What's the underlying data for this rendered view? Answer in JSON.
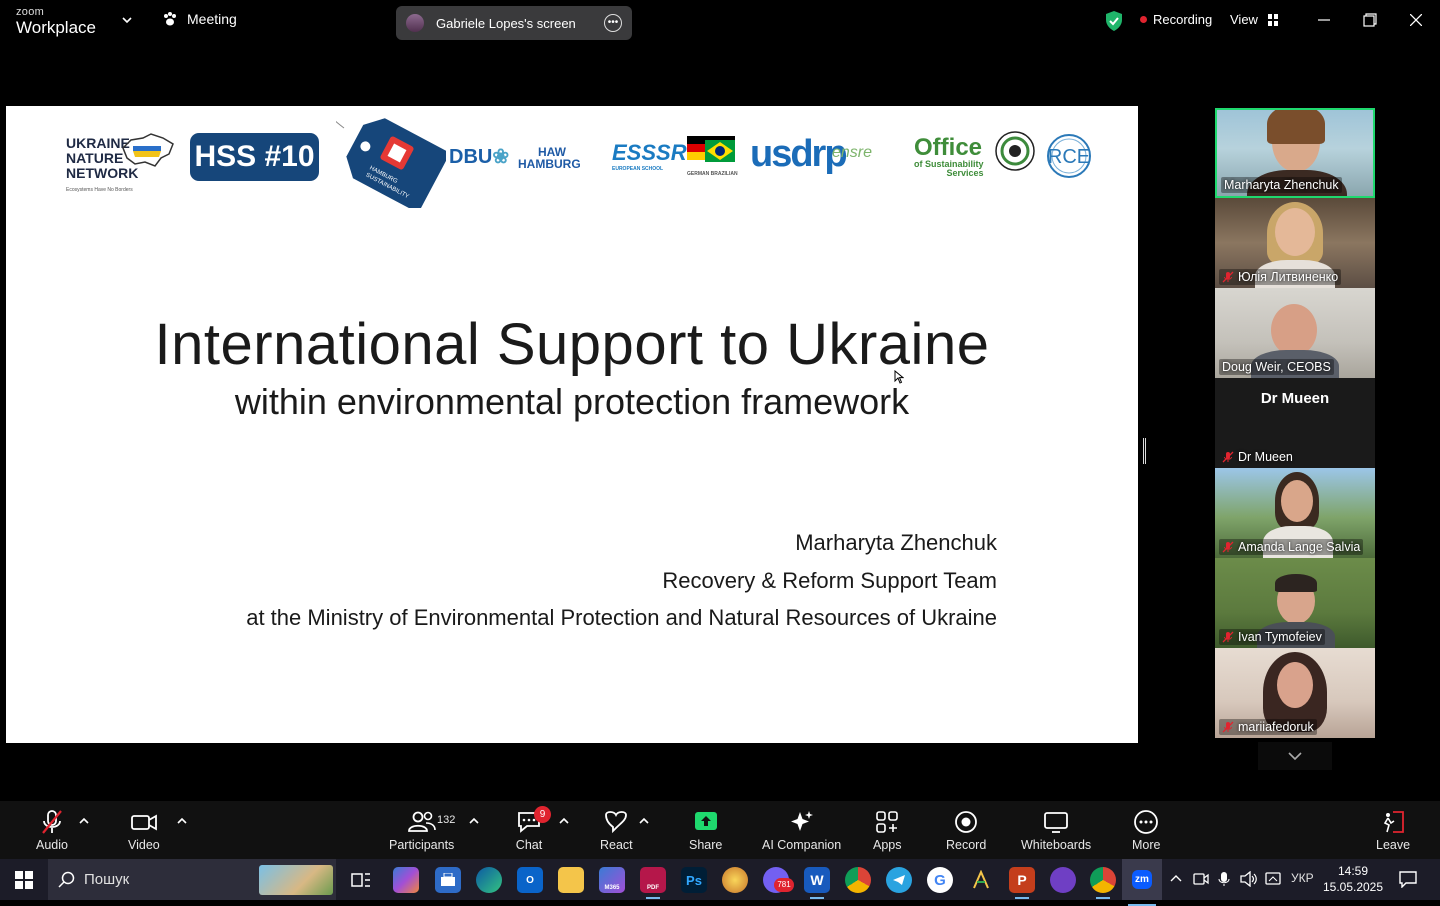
{
  "app": {
    "brand_top": "zoom",
    "brand_bottom": "Workplace",
    "meeting_label": "Meeting",
    "screen_share_label": "Gabriele Lopes's screen",
    "recording_label": "Recording",
    "view_label": "View"
  },
  "slide": {
    "hss_label": "HSS #10",
    "una_lines": [
      "UKRAINE",
      "NATURE",
      "NETWORK"
    ],
    "una_tagline": "Ecosystems Have No Borders",
    "tag_text": "HAMBURG SUSTAINABILITY SESSIONS",
    "logo_dbu": "DBU",
    "logo_haw_1": "HAW",
    "logo_haw_2": "HAMBURG",
    "logo_essr": "ESSSR",
    "logo_essr_sub": "EUROPEAN SCHOOL",
    "logo_gb": "GERMAN BRAZILIAN",
    "logo_usdrp": "usdrp",
    "logo_ensre": "ensre",
    "logo_office_1": "Office",
    "logo_office_2": "of Sustainability",
    "logo_office_3": "Services",
    "logo_rce": "RCE",
    "title": "International Support to Ukraine",
    "subtitle": "within environmental protection framework",
    "author": "Marharyta Zhenchuk",
    "team": "Recovery & Reform Support Team",
    "ministry": "at the Ministry of Environmental Protection and Natural Resources of Ukraine"
  },
  "participants": [
    {
      "name": "Marharyta Zhenchuk",
      "muted": false,
      "active": true
    },
    {
      "name": "Юлія Литвиненко",
      "muted": true,
      "active": false
    },
    {
      "name": "Doug Weir, CEOBS",
      "muted": false,
      "active": false
    },
    {
      "name": "Dr Mueen",
      "muted": true,
      "active": false,
      "video_off": true
    },
    {
      "name": "Amanda Lange Salvia",
      "muted": true,
      "active": false
    },
    {
      "name": "Ivan Tymofeiev",
      "muted": true,
      "active": false
    },
    {
      "name": "mariiafedoruk",
      "muted": true,
      "active": false
    }
  ],
  "toolbar": {
    "audio": "Audio",
    "video": "Video",
    "participants": "Participants",
    "participants_count": "132",
    "chat": "Chat",
    "chat_badge": "9",
    "react": "React",
    "share": "Share",
    "ai_companion": "AI Companion",
    "apps": "Apps",
    "record": "Record",
    "whiteboards": "Whiteboards",
    "more": "More",
    "leave": "Leave"
  },
  "taskbar": {
    "search_placeholder": "Пошук",
    "viber_badge": "781",
    "language": "УКР",
    "time": "14:59",
    "date": "15.05.2025",
    "m365_label": "M365",
    "pdf_label": "PDF",
    "ps_label": "Ps",
    "word_label": "W",
    "ppt_label": "P",
    "zoom_label": "zm",
    "outlook_label": "O"
  },
  "colors": {
    "share_green": "#1fd96e",
    "record_red": "#e0242f",
    "hss_blue": "#16467a"
  }
}
